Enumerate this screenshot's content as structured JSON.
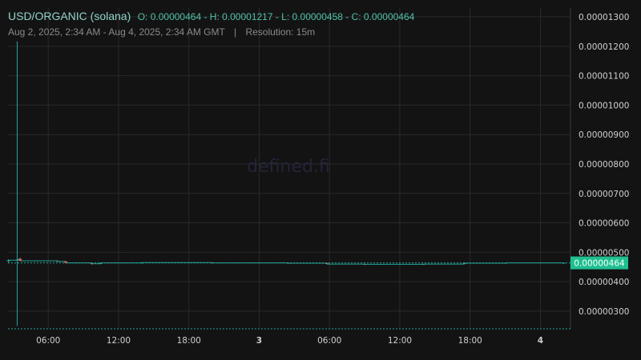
{
  "header": {
    "pair": "USD/ORGANIC (solana)",
    "ohlc": "O: 0.00000464 - H: 0.00001217 - L: 0.00000458 - C: 0.00000464",
    "range": "Aug 2, 2025, 2:34 AM - Aug 4, 2025, 2:34 AM GMT",
    "separator": "|",
    "resolution": "Resolution: 15m"
  },
  "watermark": "defined.fi",
  "colors": {
    "background": "#131313",
    "grid": "#2a2a2a",
    "up": "#26a69a",
    "down": "#ef5350",
    "price_label_bg": "#1fbf90"
  },
  "chart_data": {
    "type": "candlestick",
    "title": "USD/ORGANIC (solana)",
    "ylim": [
      2.4e-06,
      1.33e-05
    ],
    "y_ticks": [
      "0.00001300",
      "0.00001200",
      "0.00001100",
      "0.00001000",
      "0.00000900",
      "0.00000800",
      "0.00000700",
      "0.00000600",
      "0.00000500",
      "0.00000400",
      "0.00000300"
    ],
    "x_ticks": [
      {
        "label": "06:00",
        "day": false
      },
      {
        "label": "12:00",
        "day": false
      },
      {
        "label": "18:00",
        "day": false
      },
      {
        "label": "3",
        "day": true
      },
      {
        "label": "06:00",
        "day": false
      },
      {
        "label": "12:00",
        "day": false
      },
      {
        "label": "18:00",
        "day": false
      },
      {
        "label": "4",
        "day": true
      }
    ],
    "x_start_hour": 2.5667,
    "x_end_hour": 50.5667,
    "candles": [
      {
        "t": 2.6,
        "o": 4.7e-06,
        "h": 4.76e-06,
        "l": 4.66e-06,
        "c": 4.73e-06
      },
      {
        "t": 3.35,
        "o": 4.73e-06,
        "h": 1.217e-05,
        "l": 2.5e-06,
        "c": 4.75e-06
      },
      {
        "t": 3.6,
        "o": 4.78e-06,
        "h": 4.81e-06,
        "l": 4.7e-06,
        "c": 4.71e-06
      },
      {
        "t": 6.8,
        "o": 4.71e-06,
        "h": 4.72e-06,
        "l": 4.68e-06,
        "c": 4.69e-06
      },
      {
        "t": 7.5,
        "o": 4.69e-06,
        "h": 4.7e-06,
        "l": 4.62e-06,
        "c": 4.64e-06
      },
      {
        "t": 9.7,
        "o": 4.64e-06,
        "h": 4.65e-06,
        "l": 4.58e-06,
        "c": 4.61e-06
      },
      {
        "t": 10.5,
        "o": 4.61e-06,
        "h": 4.66e-06,
        "l": 4.6e-06,
        "c": 4.64e-06
      },
      {
        "t": 14.0,
        "o": 4.64e-06,
        "h": 4.66e-06,
        "l": 4.62e-06,
        "c": 4.65e-06
      },
      {
        "t": 20.0,
        "o": 4.65e-06,
        "h": 4.66e-06,
        "l": 4.63e-06,
        "c": 4.64e-06
      },
      {
        "t": 26.5,
        "o": 4.64e-06,
        "h": 4.65e-06,
        "l": 4.61e-06,
        "c": 4.63e-06
      },
      {
        "t": 29.8,
        "o": 4.63e-06,
        "h": 4.64e-06,
        "l": 4.59e-06,
        "c": 4.6e-06
      },
      {
        "t": 33.0,
        "o": 4.6e-06,
        "h": 4.61e-06,
        "l": 4.58e-06,
        "c": 4.59e-06
      },
      {
        "t": 38.0,
        "o": 4.59e-06,
        "h": 4.61e-06,
        "l": 4.58e-06,
        "c": 4.6e-06
      },
      {
        "t": 41.5,
        "o": 4.6e-06,
        "h": 4.65e-06,
        "l": 4.59e-06,
        "c": 4.63e-06
      },
      {
        "t": 45.0,
        "o": 4.63e-06,
        "h": 4.65e-06,
        "l": 4.62e-06,
        "c": 4.64e-06
      },
      {
        "t": 50.0,
        "o": 4.64e-06,
        "h": 4.65e-06,
        "l": 4.63e-06,
        "c": 4.64e-06
      }
    ],
    "last_price": "0.00000464",
    "last_value": 4.64e-06
  }
}
